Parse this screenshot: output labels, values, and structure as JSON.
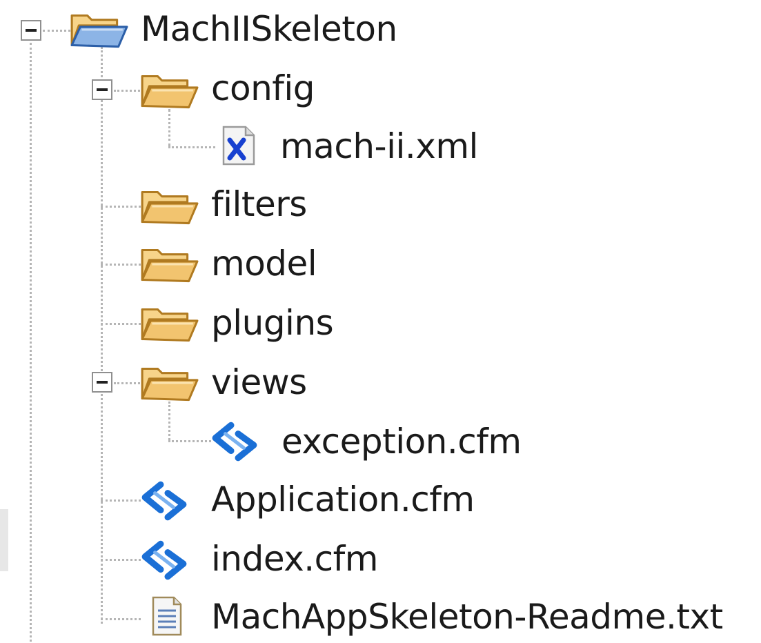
{
  "tree": {
    "root": {
      "label": "MachIISkeleton",
      "icon": "folder-open-blue-icon",
      "expanded": true
    },
    "items": [
      {
        "label": "config",
        "icon": "folder-open-icon",
        "expanded": true
      },
      {
        "label": "mach-ii.xml",
        "icon": "xml-file-icon"
      },
      {
        "label": "filters",
        "icon": "folder-open-icon"
      },
      {
        "label": "model",
        "icon": "folder-open-icon"
      },
      {
        "label": "plugins",
        "icon": "folder-open-icon"
      },
      {
        "label": "views",
        "icon": "folder-open-icon",
        "expanded": true
      },
      {
        "label": "exception.cfm",
        "icon": "cfm-file-icon"
      },
      {
        "label": "Application.cfm",
        "icon": "cfm-file-icon"
      },
      {
        "label": "index.cfm",
        "icon": "cfm-file-icon"
      },
      {
        "label": "MachAppSkeleton-Readme.txt",
        "icon": "text-file-icon"
      }
    ]
  },
  "colors": {
    "folder_fill": "#f2c46f",
    "folder_stroke": "#b07a20",
    "root_folder_fill": "#8cb4e6",
    "cfm_blue": "#1a6fd6",
    "xml_blue": "#1740d0",
    "connector": "#b5b5b5"
  }
}
